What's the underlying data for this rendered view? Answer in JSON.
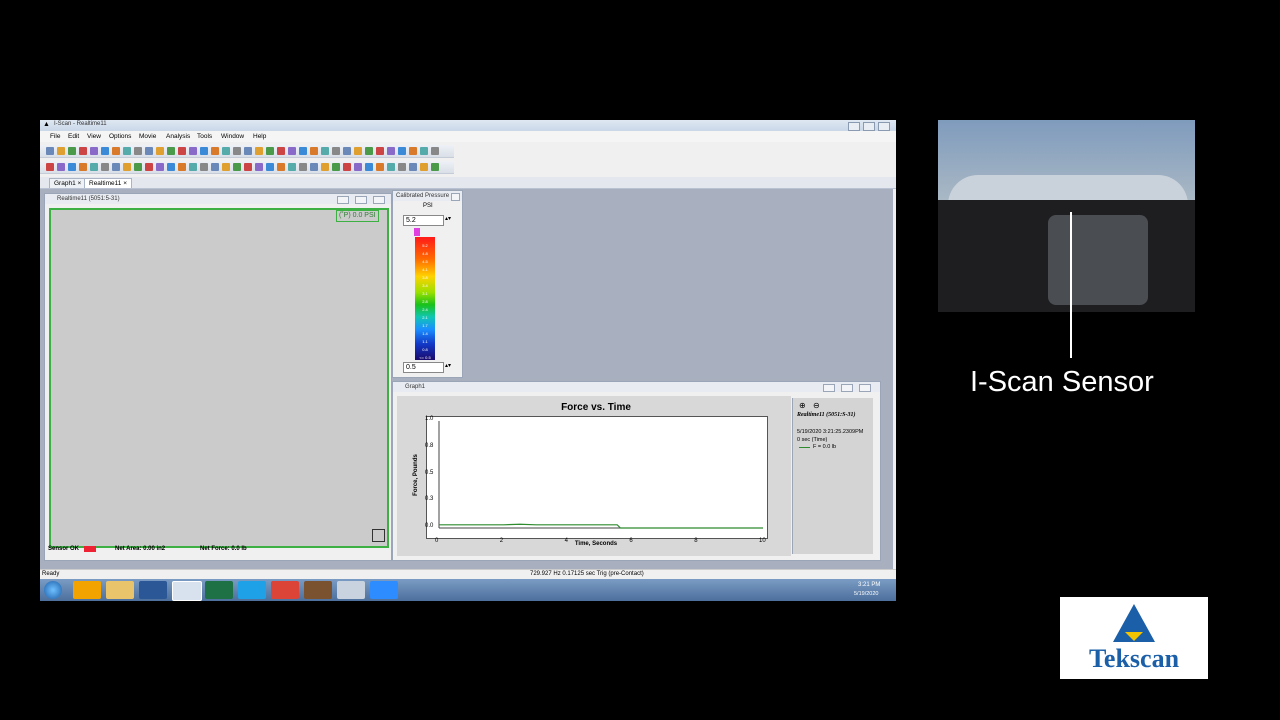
{
  "app": {
    "title": "I-Scan - Realtime11",
    "menu": [
      "File",
      "Edit",
      "View",
      "Options",
      "Movie",
      "Analysis",
      "Tools",
      "Window",
      "Help"
    ],
    "tabs": [
      "Graph1",
      "Realtime11"
    ]
  },
  "realtime": {
    "title": "Realtime11 (5051:5-31)",
    "readout": "(˚P) 0.0 PSI",
    "sensor_status": "Sensor OK",
    "net_area": "Net Area: 0.00 in2",
    "net_force": "Net Force: 0.0 lb"
  },
  "pressure": {
    "title": "Calibrated Pressure",
    "unit": "PSI",
    "max_value": "5.2",
    "min_value": "0.5",
    "ticks": [
      "5.2",
      "4.8",
      "4.5",
      "4.1",
      "3.8",
      "3.4",
      "3.1",
      "2.8",
      "2.4",
      "2.1",
      "1.7",
      "1.4",
      "1.1",
      "0.8",
      "<= 0.5"
    ]
  },
  "graph": {
    "window_title": "Graph1",
    "legend_title": "Realtime11 (5051:S-31)",
    "legend_date": "5/19/2020 3:21:25.2309PM",
    "legend_time": "0 sec (Time)",
    "legend_series": "F = 0.0 lb",
    "colors": {
      "series": "#2e8b2e"
    }
  },
  "chart_data": {
    "type": "line",
    "title": "Force vs. Time",
    "xlabel": "Time, Seconds",
    "ylabel": "Force, Pounds",
    "xlim": [
      0,
      10
    ],
    "ylim": [
      0,
      1.0
    ],
    "xticks": [
      "0",
      "2",
      "4",
      "6",
      "8",
      "10"
    ],
    "yticks": [
      "0.0",
      "0.3",
      "0.5",
      "0.8",
      "1.0"
    ],
    "series": [
      {
        "name": "F = 0.0 lb",
        "x": [
          0,
          0.5,
          1,
          1.5,
          2,
          2.5,
          3,
          3.5,
          4,
          4.5,
          5,
          5.5,
          5.6,
          6,
          8,
          10
        ],
        "y": [
          0.03,
          0.03,
          0.03,
          0.03,
          0.03,
          0.035,
          0.03,
          0.03,
          0.03,
          0.03,
          0.03,
          0.03,
          0.0,
          0.0,
          0.0,
          0.0
        ]
      }
    ]
  },
  "status": {
    "left": "Ready",
    "center": "729.927 Hz 0.17125 sec Trig (pre-Contact)"
  },
  "taskbar": {
    "time": "3:21 PM",
    "date": "5/19/2020"
  },
  "overlay": {
    "caption": "I-Scan Sensor",
    "logo_text": "Tekscan"
  }
}
